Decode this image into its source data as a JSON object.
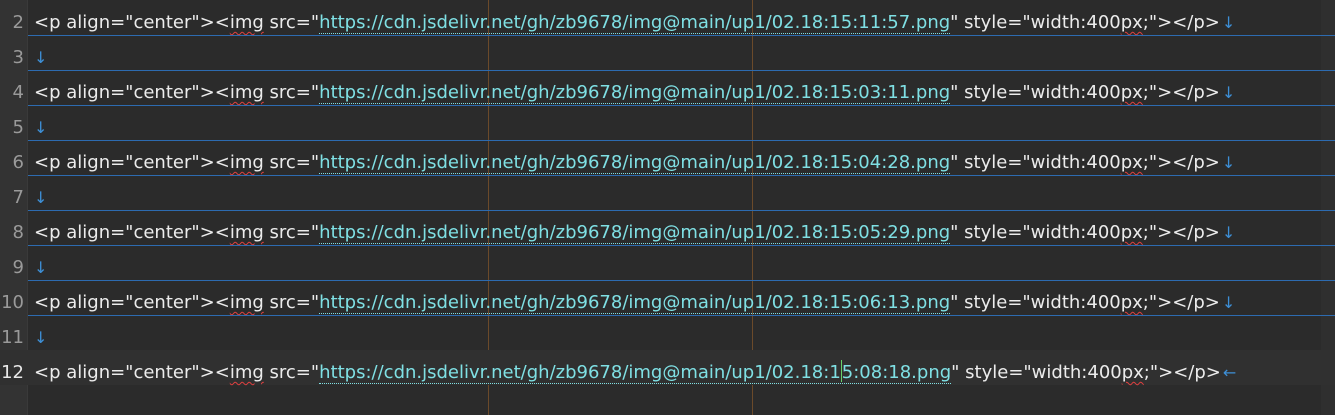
{
  "editor": {
    "lines": [
      {
        "num": "2",
        "p_open": "<p align=\"center\"><",
        "tag_img": "img",
        "src_pre": " src=\"",
        "url": "https://cdn.jsdelivr.net/gh/zb9678/img@main/up1/02.18:15:11:57.png",
        "tail_pre": "\" style=\"width:400",
        "px": "px",
        "tail_post": ";\"></p>",
        "eol": "↓"
      },
      {
        "num": "3",
        "eol": "↓"
      },
      {
        "num": "4",
        "p_open": "<p align=\"center\"><",
        "tag_img": "img",
        "src_pre": " src=\"",
        "url": "https://cdn.jsdelivr.net/gh/zb9678/img@main/up1/02.18:15:03:11.png",
        "tail_pre": "\" style=\"width:400",
        "px": "px",
        "tail_post": ";\"></p>",
        "eol": "↓"
      },
      {
        "num": "5",
        "eol": "↓"
      },
      {
        "num": "6",
        "p_open": "<p align=\"center\"><",
        "tag_img": "img",
        "src_pre": " src=\"",
        "url": "https://cdn.jsdelivr.net/gh/zb9678/img@main/up1/02.18:15:04:28.png",
        "tail_pre": "\" style=\"width:400",
        "px": "px",
        "tail_post": ";\"></p>",
        "eol": "↓"
      },
      {
        "num": "7",
        "eol": "↓"
      },
      {
        "num": "8",
        "p_open": "<p align=\"center\"><",
        "tag_img": "img",
        "src_pre": " src=\"",
        "url": "https://cdn.jsdelivr.net/gh/zb9678/img@main/up1/02.18:15:05:29.png",
        "tail_pre": "\" style=\"width:400",
        "px": "px",
        "tail_post": ";\"></p>",
        "eol": "↓"
      },
      {
        "num": "9",
        "eol": "↓"
      },
      {
        "num": "10",
        "p_open": "<p align=\"center\"><",
        "tag_img": "img",
        "src_pre": " src=\"",
        "url": "https://cdn.jsdelivr.net/gh/zb9678/img@main/up1/02.18:15:06:13.png",
        "tail_pre": "\" style=\"width:400",
        "px": "px",
        "tail_post": ";\"></p>",
        "eol": "↓"
      },
      {
        "num": "11",
        "eol": "↓"
      },
      {
        "num": "12",
        "p_open": "<p align=\"center\"><",
        "tag_img": "img",
        "src_pre": " src=\"",
        "url_a": "https://cdn.jsdelivr.net/gh/zb9678/img@main/up1/02.18:1",
        "url_b": "5:08:18.png",
        "tail_pre": "\" style=\"width:400",
        "px": "px",
        "tail_post": ";\"></p>",
        "eol": "←"
      }
    ]
  },
  "colors": {
    "background": "#2b2b2b",
    "url": "#7fe0e4",
    "separator": "#2d6bb0",
    "spellcheck": "#e04040",
    "cursor": "#67d16a"
  }
}
